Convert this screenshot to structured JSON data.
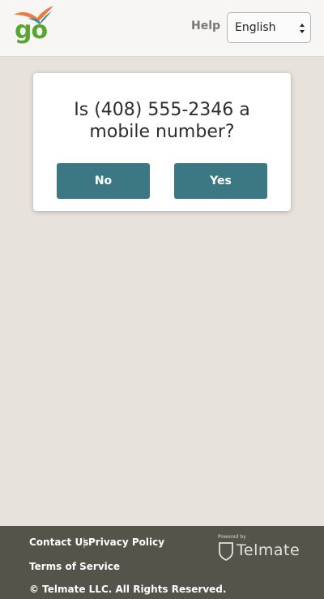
{
  "header": {
    "logo_text": "go",
    "help_label": "Help",
    "language": {
      "selected": "English"
    }
  },
  "dialog": {
    "question": "Is (408) 555-2346 a mobile number?",
    "no_label": "No",
    "yes_label": "Yes"
  },
  "footer": {
    "contact_label": "Contact Us",
    "separator": "|",
    "privacy_label": "Privacy Policy",
    "terms_label": "Terms of Service",
    "copyright": "© Telmate LLC. All Rights Reserved.",
    "powered_by": "Powered by",
    "brand": "Telmate"
  },
  "colors": {
    "page_background": "#e7e2dc",
    "button": "#3c7883",
    "footer": "#55544b",
    "logo_green": "#5aa532",
    "logo_orange": "#ee7a3b",
    "logo_teal": "#3b8e9c"
  }
}
